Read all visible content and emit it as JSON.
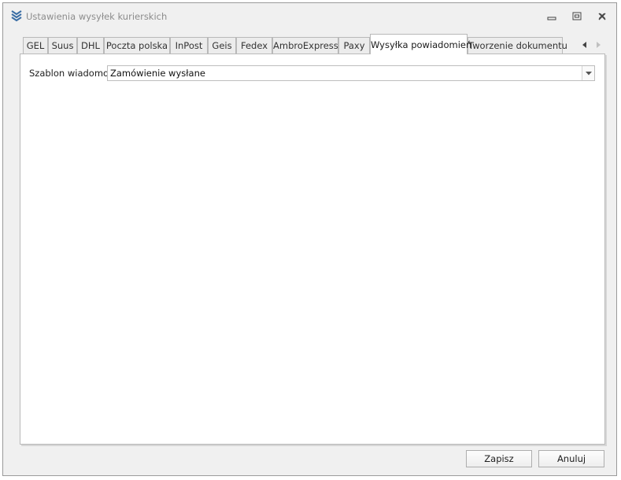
{
  "window": {
    "title": "Ustawienia wysyłek kurierskich",
    "app_icon": "chevrons-down-icon",
    "controls": [
      "minimize-icon",
      "maximize-icon",
      "close-icon"
    ]
  },
  "tabs": [
    {
      "label": "GEL",
      "active": false
    },
    {
      "label": "Suus",
      "active": false
    },
    {
      "label": "DHL",
      "active": false
    },
    {
      "label": "Poczta polska",
      "active": false
    },
    {
      "label": "InPost",
      "active": false
    },
    {
      "label": "Geis",
      "active": false
    },
    {
      "label": "Fedex",
      "active": false
    },
    {
      "label": "AmbroExpress",
      "active": false
    },
    {
      "label": "Paxy",
      "active": false
    },
    {
      "label": "Wysyłka powiadomień",
      "active": true
    },
    {
      "label": "Tworzenie dokumentu",
      "active": false
    }
  ],
  "tab_scroll": [
    "arrow-left-icon",
    "arrow-right-icon"
  ],
  "form": {
    "template_label": "Szablon wiadomości",
    "template_value": "Zamówienie wysłane"
  },
  "buttons": {
    "save": "Zapisz",
    "cancel": "Anuluj"
  },
  "colors": {
    "title_text": "#8c8c8c",
    "icon_blue": "#3a6ea5",
    "border": "#b9b9b9"
  }
}
